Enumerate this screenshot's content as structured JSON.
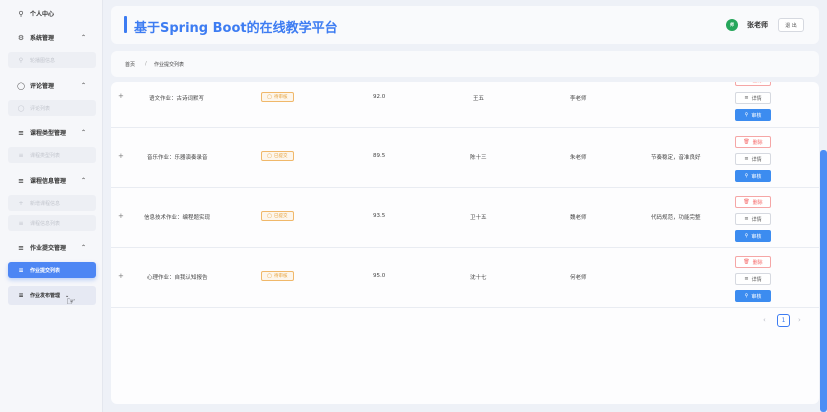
{
  "sidebar": {
    "items": [
      {
        "label": "个人中心",
        "icon": "user-icon"
      },
      {
        "label": "系统管理",
        "icon": "gear-icon"
      },
      {
        "label": "轮播图信息",
        "icon": "search-icon"
      },
      {
        "label": "评论管理",
        "icon": "chat-icon"
      },
      {
        "label": "评论列表",
        "icon": "circle-icon"
      },
      {
        "label": "课程类型管理",
        "icon": "list-icon"
      },
      {
        "label": "课程类型列表",
        "icon": "list-icon"
      },
      {
        "label": "课程信息管理",
        "icon": "list-icon"
      },
      {
        "label": "新增课程信息",
        "icon": "plus-icon"
      },
      {
        "label": "课程信息列表",
        "icon": "list-icon"
      },
      {
        "label": "作业提交管理",
        "icon": "list-icon"
      },
      {
        "label": "作业提交列表",
        "icon": "list-icon"
      },
      {
        "label": "作业发布管理",
        "icon": "list-icon"
      }
    ]
  },
  "header": {
    "title": "基于Spring Boot的在线教学平台",
    "avatar_text": "师",
    "user_name": "张老师",
    "logout": "退 出"
  },
  "breadcrumb": {
    "home": "首页",
    "sep": "/",
    "current": "作业提交列表"
  },
  "table": {
    "rows": [
      {
        "title": "语文作业：古诗词默写",
        "status": "待审核",
        "score": "92.0",
        "student": "王五",
        "teacher": "李老师",
        "comment": ""
      },
      {
        "title": "音乐作业：乐器演奏录音",
        "status": "已提交",
        "score": "89.5",
        "student": "陈十三",
        "teacher": "朱老师",
        "comment": "节奏稳定，音准良好"
      },
      {
        "title": "信息技术作业：编程题实现",
        "status": "已提交",
        "score": "93.5",
        "student": "卫十五",
        "teacher": "魏老师",
        "comment": "代码规范，功能完整"
      },
      {
        "title": "心理作业：自我认知报告",
        "status": "待审核",
        "score": "95.0",
        "student": "沈十七",
        "teacher": "何老师",
        "comment": ""
      }
    ],
    "actions": {
      "delete": "删除",
      "detail": "详情",
      "review": "审核"
    }
  },
  "pagination": {
    "current": "1",
    "prev": "‹",
    "next": "›"
  },
  "colors": {
    "accent": "#3d7cf2",
    "warning": "#e6a23c",
    "danger": "#f56c6c"
  }
}
